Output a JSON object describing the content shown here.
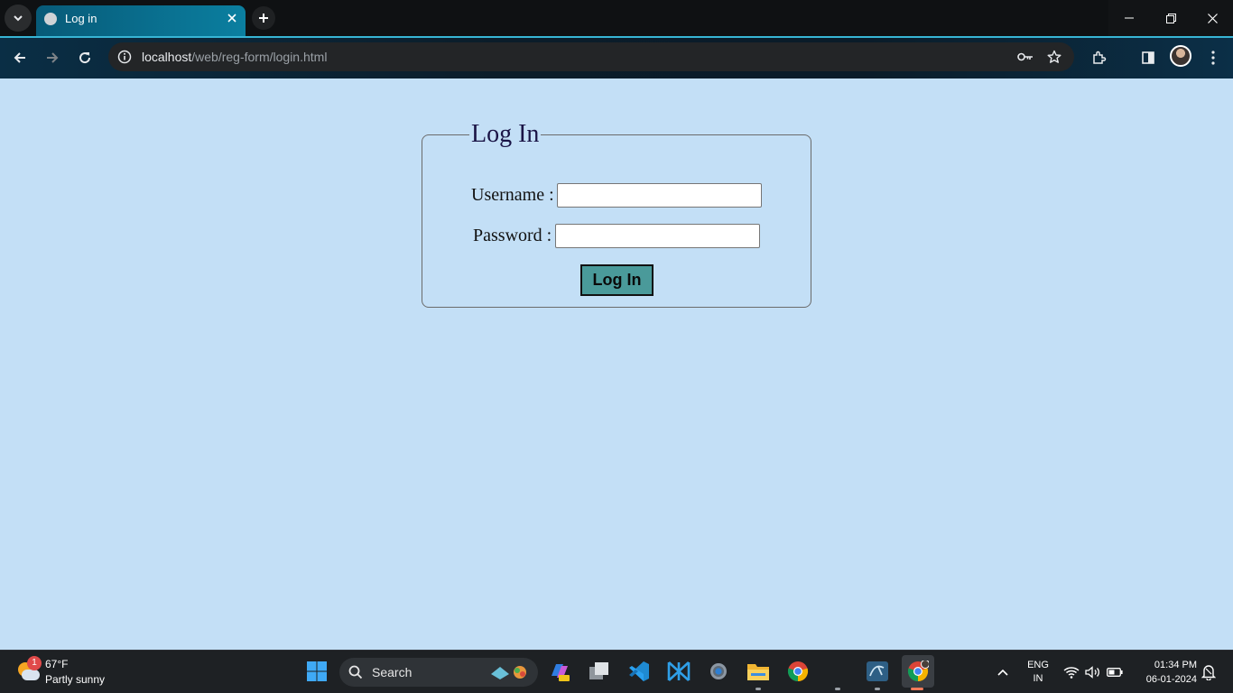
{
  "browser": {
    "tab": {
      "title": "Log in"
    },
    "address": {
      "host": "localhost",
      "path": "/web/reg-form/login.html"
    }
  },
  "page": {
    "form": {
      "legend": "Log In",
      "username_label": "Username :",
      "password_label": "Password :",
      "username_value": "",
      "password_value": "",
      "submit_label": "Log In"
    }
  },
  "taskbar": {
    "weather": {
      "temp": "67°F",
      "condition": "Partly sunny",
      "badge": "1"
    },
    "search_label": "Search",
    "language": {
      "line1": "ENG",
      "line2": "IN"
    },
    "clock": {
      "time": "01:34 PM",
      "date": "06-01-2024"
    }
  },
  "colors": {
    "page_background": "#c3dff6",
    "button_fill": "#4a9a9a",
    "legend_text": "#1a1446",
    "tab_accent": "#37b5d5"
  },
  "icons": {
    "tab_strip": [
      "tab-search-icon",
      "globe-icon",
      "close-icon",
      "plus-icon"
    ],
    "window": [
      "minimize-icon",
      "restore-icon",
      "close-icon"
    ],
    "toolbar": [
      "back-icon",
      "forward-icon",
      "reload-icon",
      "site-info-icon",
      "key-icon",
      "star-icon",
      "extensions-icon",
      "side-panel-icon",
      "menu-icon"
    ],
    "taskbar": [
      "windows-start-icon",
      "search-icon",
      "copilot-icon",
      "task-view-icon",
      "vscode-icon",
      "app-icon",
      "settings-icon",
      "file-explorer-icon",
      "chrome-icon",
      "mysql-workbench-icon",
      "chrome-profile-icon",
      "wifi-icon",
      "volume-icon",
      "battery-icon",
      "notification-icon"
    ]
  }
}
